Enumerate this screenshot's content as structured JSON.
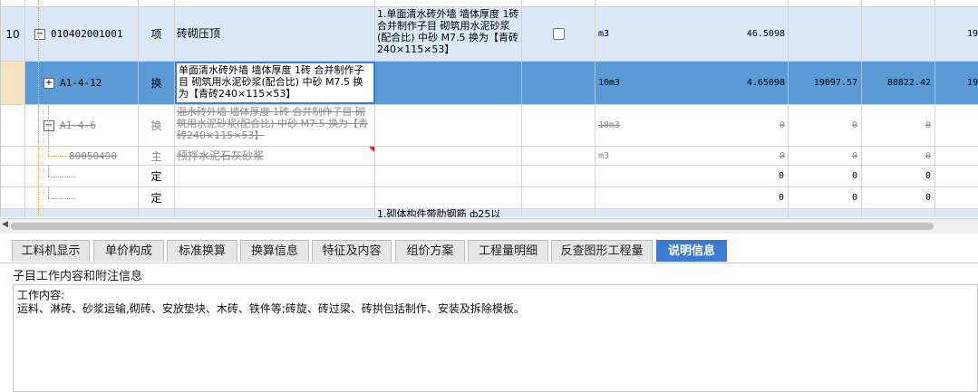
{
  "grid": {
    "rows": [
      {
        "row_no": "10",
        "code": "010402001001",
        "type": "项",
        "name": "砖砌压顶",
        "feature": "1.单面清水砖外墙 墙体厚度 1砖  合并制作子目 砌筑用水泥砂浆(配合比) 中砂 M7.5 换为【青砖240×115×53】",
        "unit": "m3",
        "quantity": "46.5098",
        "price": "",
        "total": "",
        "extra": "19"
      },
      {
        "row_no": "",
        "code": "A1-4-12",
        "type": "换",
        "name": "单面清水砖外墙 墙体厚度 1砖  合并制作子目 砌筑用水泥砂浆(配合比) 中砂 M7.5  换为【青砖240×115×53】",
        "feature": "",
        "unit": "10m3",
        "quantity": "4.65098",
        "price": "19097.57",
        "total": "88822.42",
        "extra": "19"
      },
      {
        "row_no": "",
        "code": "A1-4-6",
        "type": "换",
        "name": "混水砖外墙 墙体厚度 1砖  合并制作子目 砌筑用水泥砂浆(配合比) 中砂 M7.5  换为【青砖240×115×53】",
        "feature": "",
        "unit": "10m3",
        "quantity": "0",
        "price": "0",
        "total": "0",
        "extra": ""
      },
      {
        "row_no": "",
        "code": "80050490",
        "type": "主",
        "name": "预拌水泥石灰砂浆",
        "feature": "",
        "unit": "m3",
        "quantity": "0",
        "price": "0",
        "total": "0",
        "extra": ""
      },
      {
        "row_no": "",
        "code": "",
        "type": "定",
        "name": "",
        "feature": "",
        "unit": "",
        "quantity": "0",
        "price": "0",
        "total": "0",
        "extra": ""
      },
      {
        "row_no": "",
        "code": "",
        "type": "定",
        "name": "",
        "feature": "",
        "unit": "",
        "quantity": "0",
        "price": "0",
        "total": "0",
        "extra": ""
      },
      {
        "row_no": "",
        "code": "",
        "type": "",
        "name": "",
        "feature": "1.砌体构件带肋钢筋 ф25以",
        "unit": "",
        "quantity": "",
        "price": "",
        "total": "",
        "extra": ""
      }
    ]
  },
  "tabs": [
    "工料机显示",
    "单价构成",
    "标准换算",
    "换算信息",
    "特征及内容",
    "组价方案",
    "工程量明细",
    "反查图形工程量",
    "说明信息"
  ],
  "active_tab": "说明信息",
  "panel": {
    "title": "子目工作内容和附注信息",
    "line1": "工作内容:",
    "line2": "运料、淋砖、砂浆运输,砌砖、安放垫块、木砖、铁件等;砖旋、砖过梁、砖拱包括制作、安装及拆除模板。"
  },
  "colors": {
    "selected_row": "#5b9bd5",
    "highlight_row": "#dce8f7",
    "active_tab": "#3b7bd3",
    "tree_line": "#c9a14a"
  }
}
